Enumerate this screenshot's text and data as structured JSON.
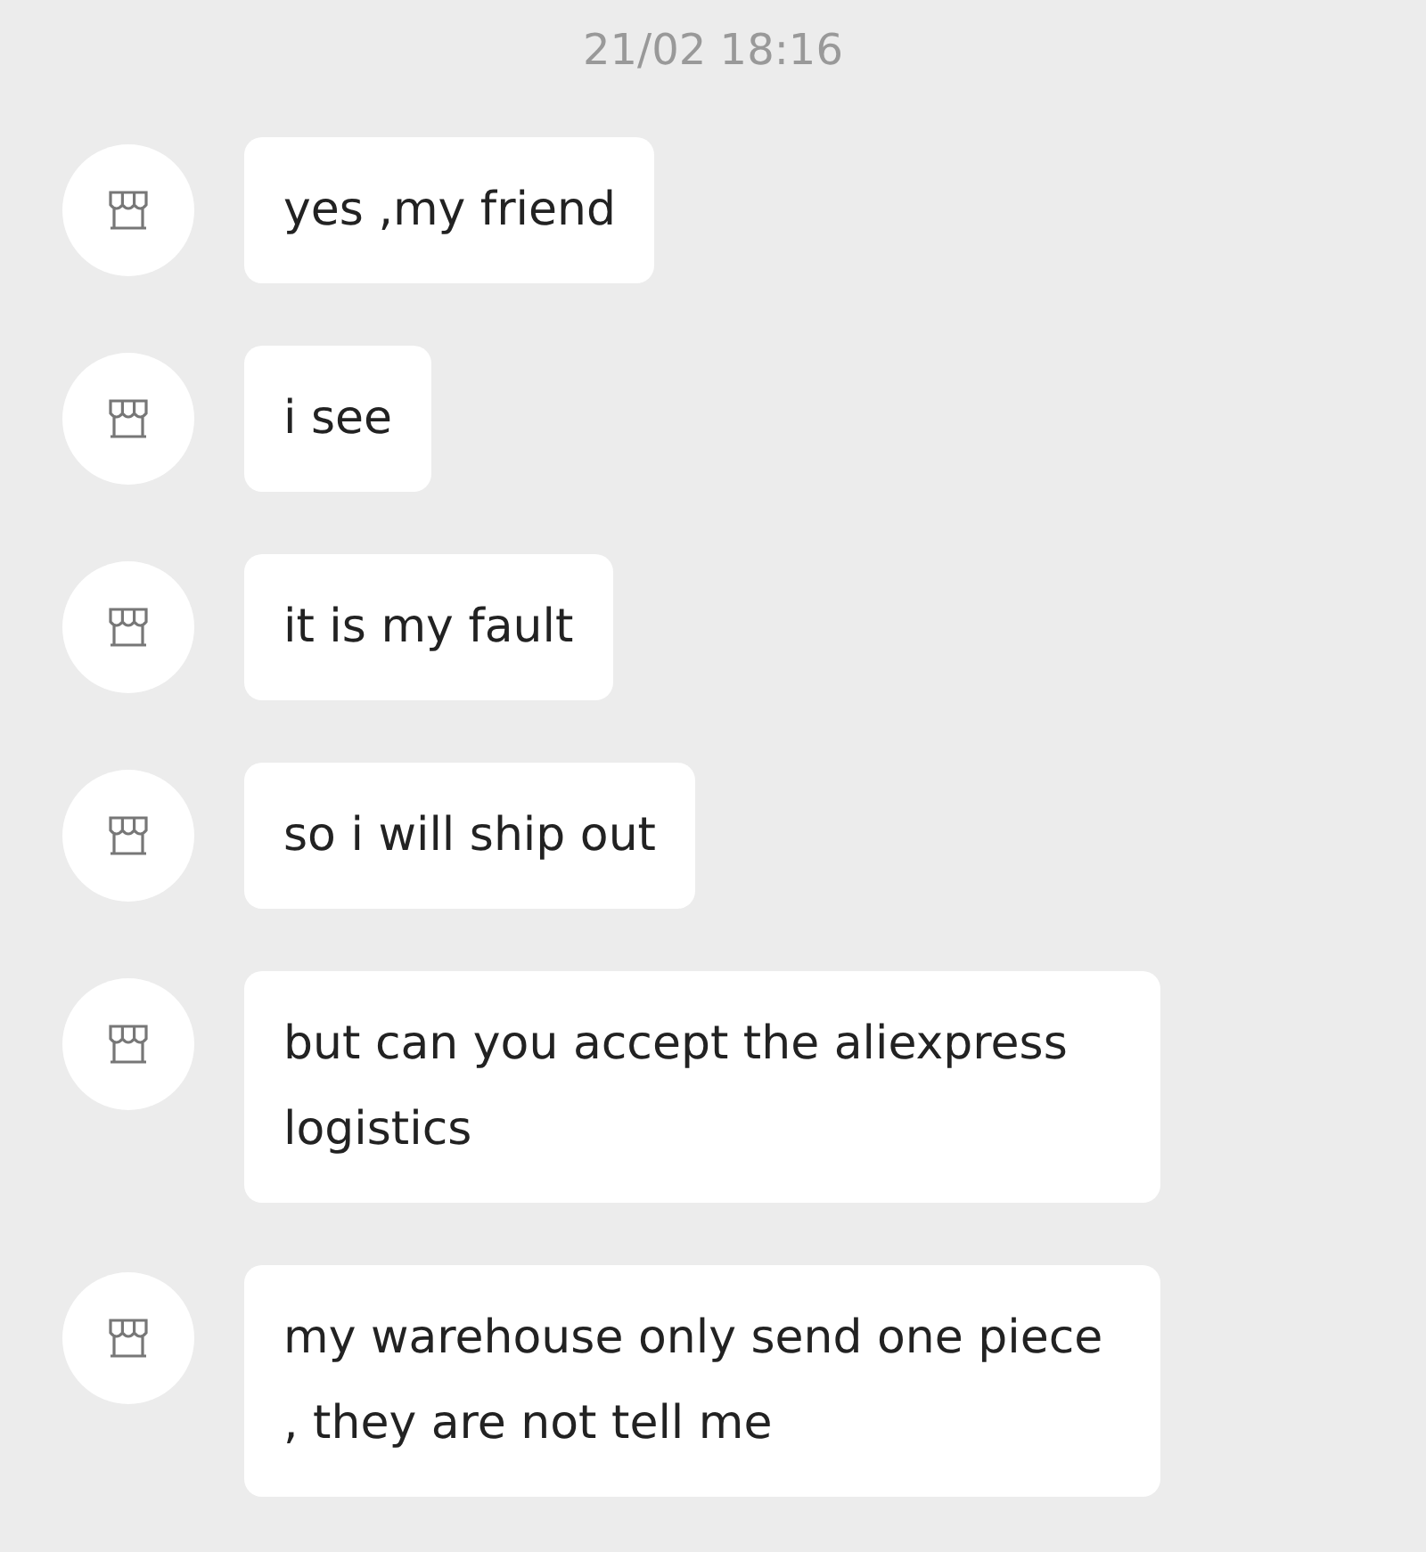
{
  "timestamp": "21/02 18:16",
  "messages": [
    {
      "text": "yes ,my friend"
    },
    {
      "text": "i see"
    },
    {
      "text": "it is my fault"
    },
    {
      "text": "so i will ship out"
    },
    {
      "text": "but can you accept the aliexpress logistics"
    },
    {
      "text": "my warehouse only send one piece , they are not tell me"
    }
  ]
}
